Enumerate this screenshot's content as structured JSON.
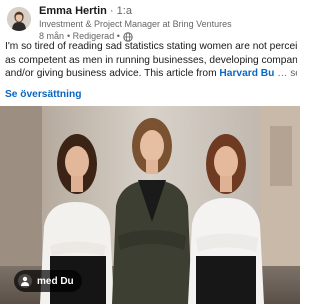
{
  "post": {
    "author": {
      "name": "Emma Hertin",
      "degree": "· 1:a",
      "headline": "Investment & Project Manager at Bring Ventures",
      "time": "8 mån",
      "edited": "• Redigerad •"
    },
    "text": {
      "line1": "I'm so tired of reading sad statistics stating women are not perceived",
      "line2": "as competent as men in running businesses, developing companies",
      "line3_prefix": "and/or giving business advice. This article from ",
      "link": "Harvard Bu",
      "more": "… se mer"
    },
    "translate_label": "Se översättning",
    "image": {
      "tag_label": "med Du"
    }
  },
  "icons": {
    "visibility": "globe-icon",
    "tag": "person-icon"
  },
  "colors": {
    "link": "#0a66c2",
    "secondary_text": "#666666",
    "primary_text": "#191919",
    "tag_background": "#000000b3"
  }
}
